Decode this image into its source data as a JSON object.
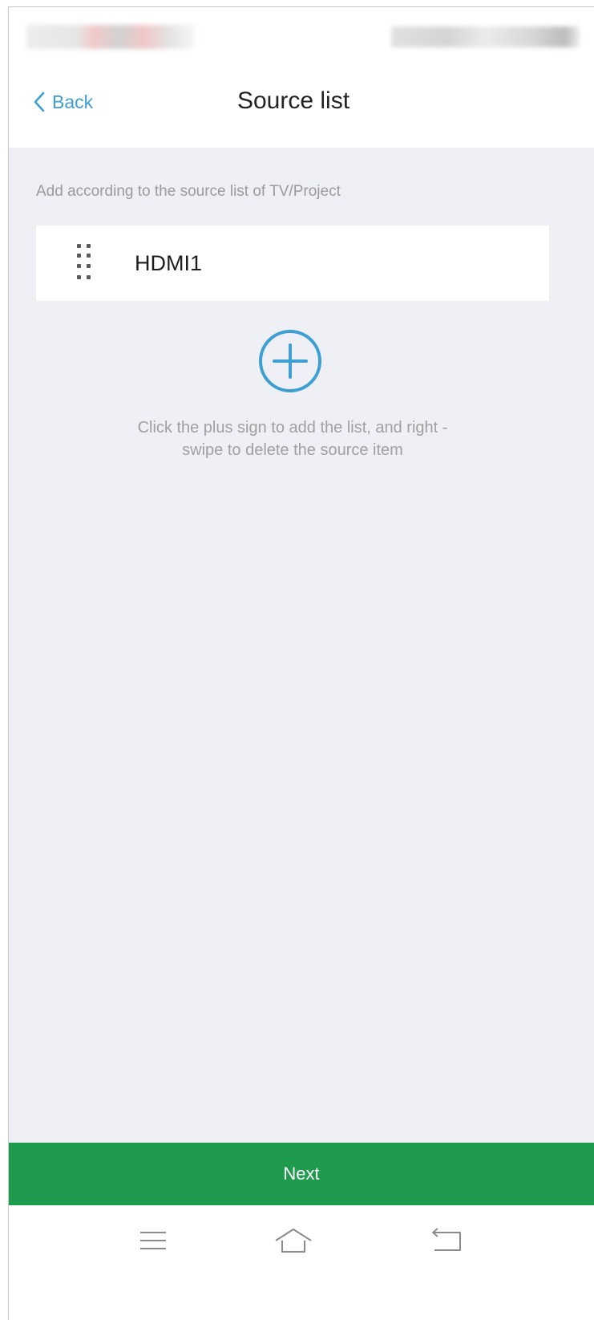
{
  "header": {
    "back_label": "Back",
    "title": "Source list"
  },
  "content": {
    "hint_top": "Add according to the source list of TV/Project",
    "sources": [
      {
        "label": "HDMI1"
      }
    ],
    "hint_bottom_line1": "Click the plus sign to add the list, and right -",
    "hint_bottom_line2": "swipe to delete the source item"
  },
  "footer": {
    "next_label": "Next"
  },
  "colors": {
    "accent": "#3d9fd3",
    "primary_button": "#1f9b4e",
    "content_bg": "#eff0f5"
  },
  "icons": {
    "back": "chevron-left-icon",
    "drag": "drag-handle-icon",
    "add": "plus-circle-icon",
    "nav_menu": "menu-icon",
    "nav_home": "home-icon",
    "nav_back": "return-icon"
  }
}
